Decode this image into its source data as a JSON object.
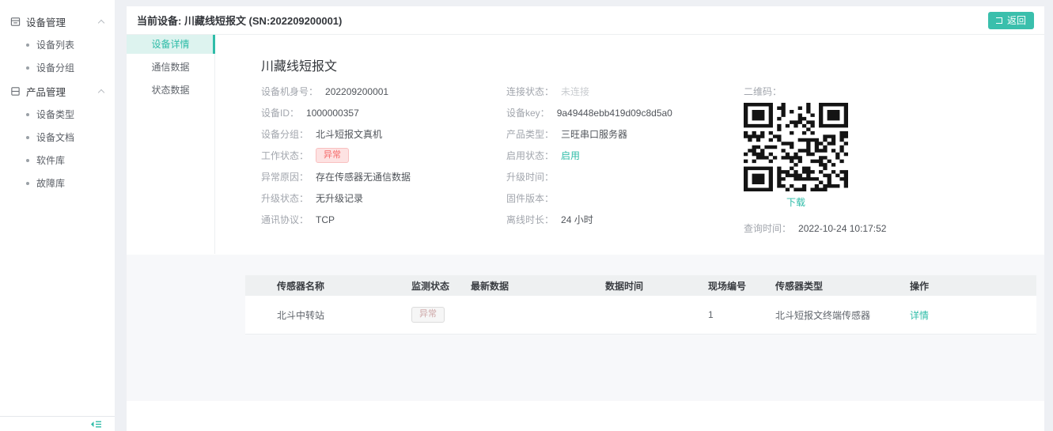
{
  "colors": {
    "accent": "#2fbca8",
    "danger": "#f56c6c"
  },
  "sidebar": {
    "groups": [
      {
        "label": "设备管理",
        "icon": "device-management-icon",
        "children": [
          {
            "label": "设备列表"
          },
          {
            "label": "设备分组"
          }
        ]
      },
      {
        "label": "产品管理",
        "icon": "product-management-icon",
        "children": [
          {
            "label": "设备类型"
          },
          {
            "label": "设备文档"
          },
          {
            "label": "软件库"
          },
          {
            "label": "故障库"
          }
        ]
      }
    ]
  },
  "header": {
    "title": "当前设备: 川藏线短报文 (SN:202209200001)",
    "return_label": "返回"
  },
  "tabs": [
    {
      "label": "设备详情"
    },
    {
      "label": "通信数据"
    },
    {
      "label": "状态数据"
    }
  ],
  "detail": {
    "title": "川藏线短报文",
    "col1": [
      {
        "label": "设备机身号：",
        "value": "202209200001"
      },
      {
        "label": "设备ID：",
        "value": "1000000357"
      },
      {
        "label": "设备分组：",
        "value": "北斗短报文真机"
      },
      {
        "label": "工作状态：",
        "value": "异常"
      },
      {
        "label": "异常原因：",
        "value": "存在传感器无通信数据"
      },
      {
        "label": "升级状态：",
        "value": "无升级记录"
      },
      {
        "label": "通讯协议：",
        "value": "TCP"
      }
    ],
    "col2": [
      {
        "label": "连接状态：",
        "value": "未连接"
      },
      {
        "label": "设备key：",
        "value": "9a49448ebb419d09c8d5a0"
      },
      {
        "label": "产品类型：",
        "value": "三旺串口服务器"
      },
      {
        "label": "启用状态：",
        "value": "启用"
      },
      {
        "label": "升级时间：",
        "value": ""
      },
      {
        "label": "固件版本：",
        "value": ""
      },
      {
        "label": "离线时长：",
        "value": "24 小时"
      }
    ],
    "qr": {
      "label": "二维码：",
      "download": "下载"
    },
    "query": {
      "label": "查询时间：",
      "value": "2022-10-24 10:17:52"
    }
  },
  "table": {
    "headers": [
      "传感器名称",
      "监测状态",
      "最新数据",
      "数据时间",
      "现场编号",
      "传感器类型",
      "操作"
    ],
    "rows": [
      {
        "name": "北斗中转站",
        "status": "异常",
        "latest": "",
        "time": "",
        "site_no": "1",
        "type": "北斗短报文终端传感器",
        "action": "详情"
      }
    ]
  }
}
